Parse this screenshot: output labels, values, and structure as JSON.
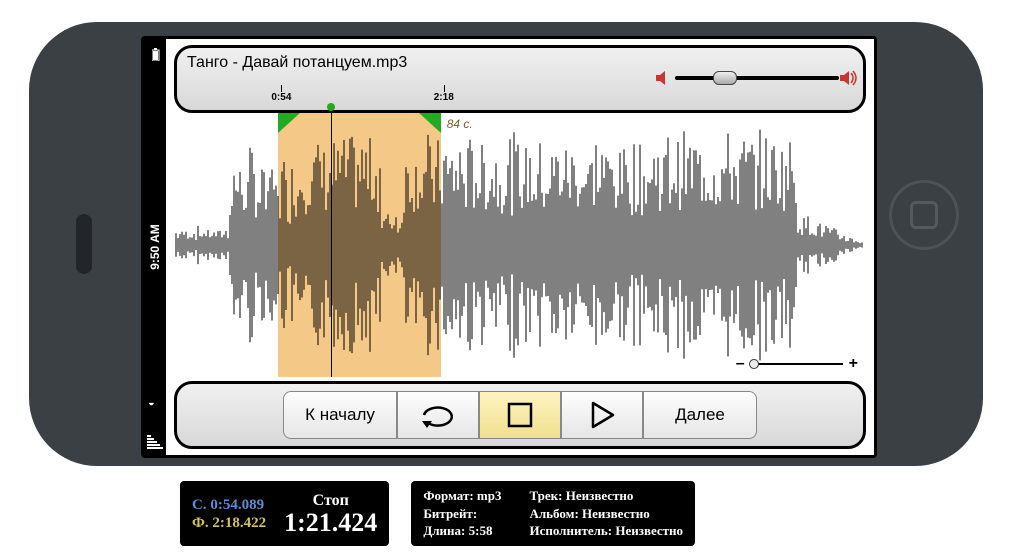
{
  "status": {
    "time": "9:50 AM"
  },
  "top": {
    "file_name": "Танго - Давай потанцуем.mp3",
    "sel_start_label": "0:54",
    "sel_end_label": "2:18",
    "sel_duration_label": "84 с."
  },
  "volume": {
    "percent": 30
  },
  "waveform": {
    "total_seconds": 358,
    "sel_start_seconds": 54,
    "sel_end_seconds": 138,
    "playhead_seconds": 81
  },
  "zoom": {
    "minus": "–",
    "plus": "+"
  },
  "controls": {
    "restart": "К началу",
    "next": "Далее"
  },
  "footer": {
    "s_label": "С.",
    "s_value": "0:54.089",
    "f_label": "Ф.",
    "f_value": "2:18.422",
    "state": "Стоп",
    "elapsed": "1:21.424",
    "format_label": "Формат:",
    "format_value": "mp3",
    "bitrate_label": "Битрейт:",
    "bitrate_value": "",
    "length_label": "Длина:",
    "length_value": "5:58",
    "track_label": "Трек:",
    "track_value": "Неизвестно",
    "album_label": "Альбом:",
    "album_value": "Неизвестно",
    "artist_label": "Исполнитель:",
    "artist_value": "Неизвестно"
  }
}
